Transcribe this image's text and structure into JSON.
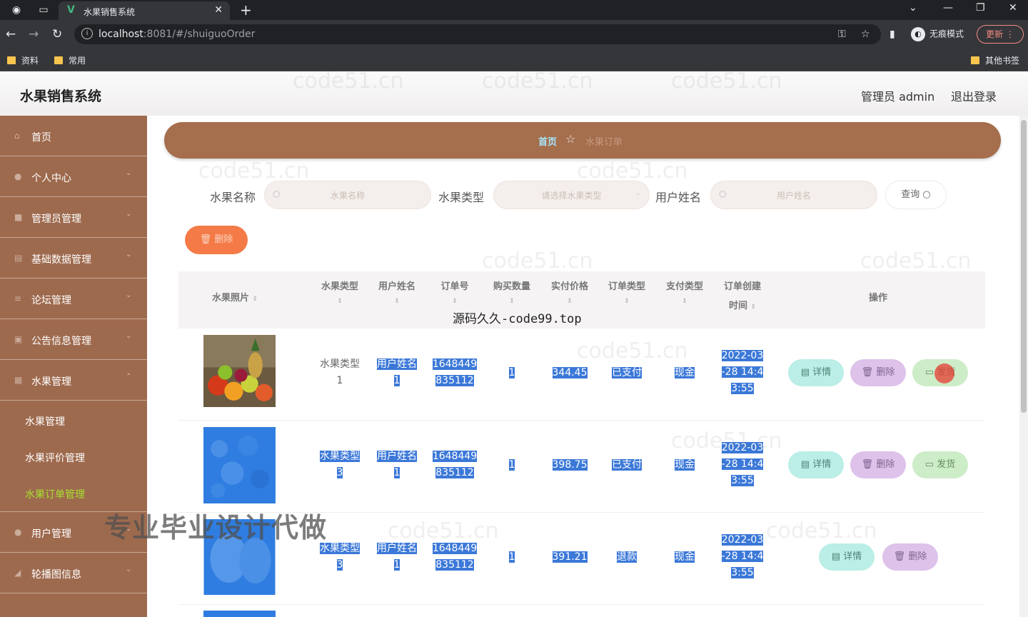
{
  "browser": {
    "tab_title": "水果销售系统",
    "url_host": "localhost",
    "url_rest": ":8081/#/shuiguoOrder",
    "incognito_label": "无痕模式",
    "update_label": "更新",
    "bookmarks": [
      "资料",
      "常用"
    ],
    "other_bookmarks": "其他书签"
  },
  "header": {
    "title": "水果销售系统",
    "user": "管理员 admin",
    "logout": "退出登录"
  },
  "sidebar": {
    "items": [
      {
        "label": "首页"
      },
      {
        "label": "个人中心"
      },
      {
        "label": "管理员管理"
      },
      {
        "label": "基础数据管理"
      },
      {
        "label": "论坛管理"
      },
      {
        "label": "公告信息管理"
      },
      {
        "label": "水果管理"
      }
    ],
    "subitems": [
      {
        "label": "水果管理"
      },
      {
        "label": "水果评价管理"
      },
      {
        "label": "水果订单管理"
      }
    ],
    "after": [
      {
        "label": "用户管理"
      },
      {
        "label": "轮播图信息"
      }
    ]
  },
  "breadcrumb": {
    "home": "首页",
    "current": "水果订单"
  },
  "filters": {
    "name_label": "水果名称",
    "name_placeholder": "水果名称",
    "type_label": "水果类型",
    "type_placeholder": "请选择水果类型",
    "user_label": "用户姓名",
    "user_placeholder": "用户姓名",
    "query": "查询"
  },
  "batch_delete": "删除",
  "table": {
    "columns": {
      "photo": "水果照片",
      "type": "水果类型",
      "user": "用户姓名",
      "order_no": "订单号",
      "qty": "购买数量",
      "price": "实付价格",
      "order_type": "订单类型",
      "pay_type": "支付类型",
      "created_1": "订单创建",
      "created_2": "时间",
      "actions": "操作"
    },
    "rows": [
      {
        "type_1": "水果类型",
        "type_2": "1",
        "user_1": "用户姓名",
        "user_2": "1",
        "order_1": "1648449",
        "order_2": "835112",
        "qty": "1",
        "price": "344.45",
        "order_type": "已支付",
        "pay": "现金",
        "time_1": "2022-03",
        "time_2": "-28 14:4",
        "time_3": "3:55",
        "detail": "详情",
        "del": "删除",
        "ship": "发货"
      },
      {
        "type_1": "水果类型",
        "type_2": "3",
        "user_1": "用户姓名",
        "user_2": "1",
        "order_1": "1648449",
        "order_2": "835112",
        "qty": "1",
        "price": "398.75",
        "order_type": "已支付",
        "pay": "现金",
        "time_1": "2022-03",
        "time_2": "-28 14:4",
        "time_3": "3:55",
        "detail": "详情",
        "del": "删除",
        "ship": "发货"
      },
      {
        "type_1": "水果类型",
        "type_2": "3",
        "user_1": "用户姓名",
        "user_2": "1",
        "order_1": "1648449",
        "order_2": "835112",
        "qty": "1",
        "price": "391.21",
        "order_type": "退款",
        "pay": "现金",
        "time_1": "2022-03",
        "time_2": "-28 14:4",
        "time_3": "3:55",
        "detail": "详情",
        "del": "删除"
      }
    ]
  },
  "overlay": {
    "source": "源码久久-code99.top",
    "promo": "专业毕业设计代做",
    "watermark": "code51.cn"
  }
}
